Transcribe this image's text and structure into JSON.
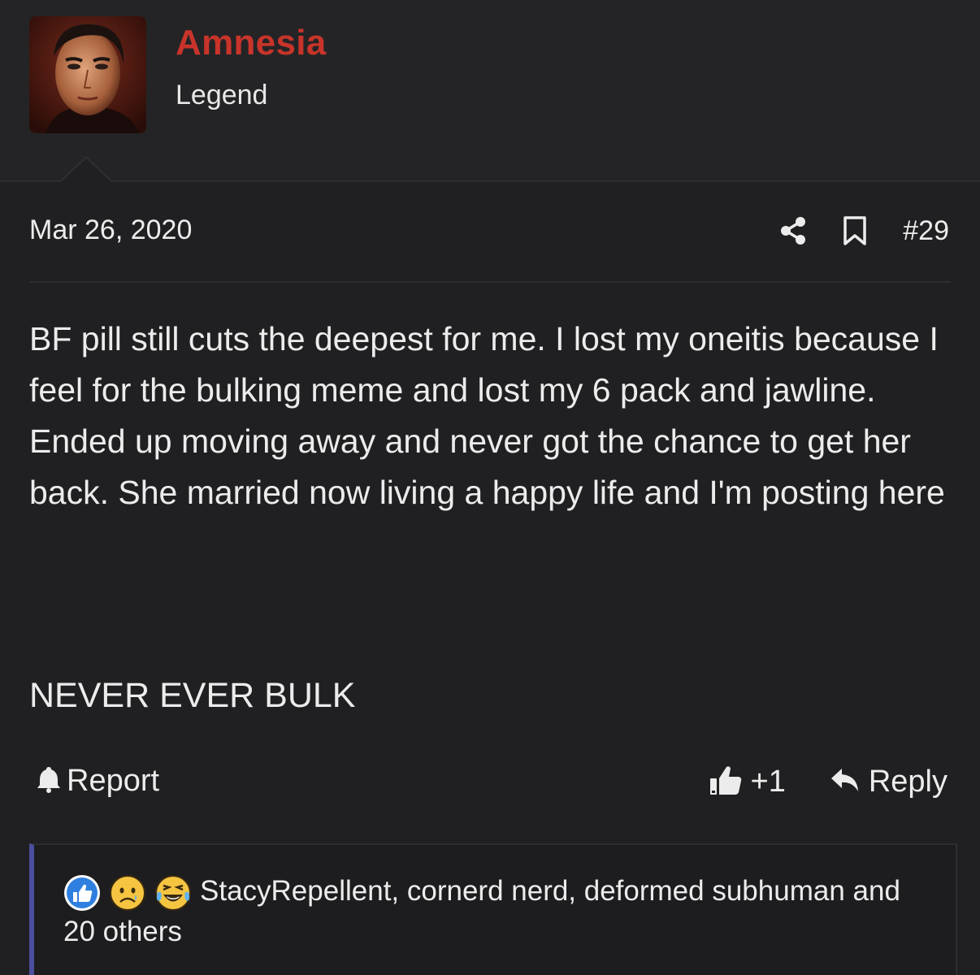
{
  "author": {
    "name": "Amnesia",
    "title": "Legend"
  },
  "post": {
    "date": "Mar 26, 2020",
    "number": "#29",
    "paragraph": "BF pill still cuts the deepest for me. I lost my oneitis because I feel for the bulking meme and lost my 6 pack and jawline. Ended up moving away and never got the chance to get her back. She married now living a happy life and I'm posting here",
    "shout": "NEVER EVER BULK"
  },
  "actions": {
    "report": "Report",
    "like_count": "+1",
    "reply": "Reply"
  },
  "reactions": {
    "icons": [
      "like-reaction-icon",
      "sad-reaction-icon",
      "laughing-crying-reaction-icon"
    ],
    "summary": "StacyRepellent, cornerd nerd, deformed subhuman and 20 others"
  },
  "colors": {
    "username": "#c8342a",
    "background": "#202022",
    "reaction_bar_accent": "#4b4f9e"
  }
}
